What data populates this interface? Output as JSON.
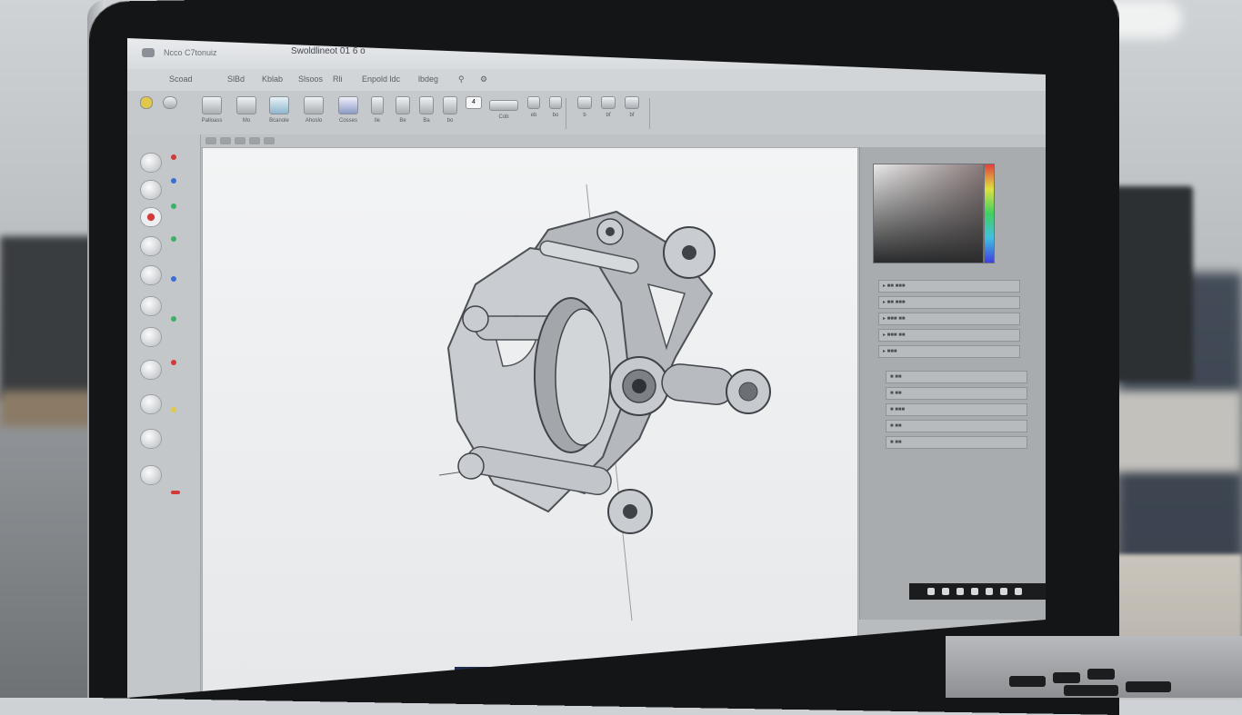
{
  "window": {
    "app_name": "Ncco  C7tonuiz",
    "document_title": "Swoldlineot  01 6 o",
    "controls": [
      "—",
      "□",
      "✕"
    ]
  },
  "menu": [
    "Scoad",
    "SlBd",
    "Kblab",
    "Slsoos",
    "Rli",
    "Enpold  ldc",
    "lbdeg"
  ],
  "ribbon": {
    "buttons": [
      {
        "label": "Palloass",
        "icon": "part-icon"
      },
      {
        "label": "Mo",
        "icon": "sketch-icon"
      },
      {
        "label": "Bcanole",
        "icon": "extrude-icon"
      },
      {
        "label": "Ahoslo",
        "icon": "revolve-icon"
      },
      {
        "label": "Cosses",
        "icon": "loft-icon"
      },
      {
        "label": "lle",
        "icon": "sweep-icon"
      },
      {
        "label": "Be",
        "icon": "fillet-icon"
      },
      {
        "label": "Ba",
        "icon": "chamfer-icon"
      },
      {
        "label": "bo",
        "icon": "shell-icon"
      },
      {
        "label": "4",
        "icon": "dimension-icon"
      },
      {
        "label": "Cob",
        "icon": "pattern-icon"
      },
      {
        "label": "eb",
        "icon": "mirror-icon"
      },
      {
        "label": "bo",
        "icon": "hole-icon"
      },
      {
        "label": "b",
        "icon": "view-front-icon"
      },
      {
        "label": "bf",
        "icon": "view-iso-icon"
      },
      {
        "label": "bf",
        "icon": "view-right-icon"
      }
    ]
  },
  "right_panel": {
    "rows": [
      "▸ ■■ ■■■",
      "▸ ■■ ■■■",
      "▸ ■■■ ■■",
      "▸ ■■■ ■■",
      "▸ ■■■",
      "  ■ ■■",
      "  ■ ■■",
      "  ■ ■■■",
      "  ■ ■■",
      "  ■ ■■"
    ]
  },
  "colors": {
    "viewport_bg": "#eceef0",
    "model_light": "#c9ccd0",
    "model_dark": "#5f6368",
    "accent_red": "#d23a3a",
    "accent_green": "#3ab06a",
    "accent_blue": "#3a6fd2",
    "taskbar": "#1e2c52"
  }
}
